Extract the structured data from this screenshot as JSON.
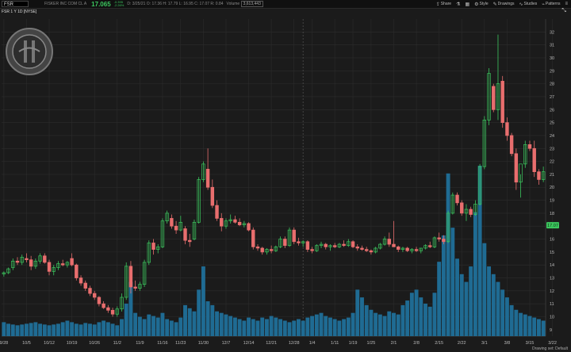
{
  "header": {
    "symbol": "FSR",
    "company": "FISKER INC COM CL A",
    "last": "17.065",
    "change": "-0.395",
    "change_pct": "-2.26%",
    "quote": "D: 3/25/21  O: 17.36  H: 17.79  L: 16.95  C: 17.07  R: 0.84",
    "volume_label": "Volume",
    "volume_value": "3,613,443",
    "period": "FSR 1 Y 1D [NYSE]"
  },
  "toolbar": {
    "share": "Share",
    "style": "Style",
    "drawings": "Drawings",
    "studies": "Studies",
    "patterns": "Patterns"
  },
  "logo_text": "FISKER",
  "status": "Drawing set: Default",
  "price_tag": "17.07",
  "colors": {
    "up": "#3cc65e",
    "down": "#e86e6e",
    "volume": "#1f6b93",
    "background": "#1b1b1b",
    "grid": "#2c2c2c"
  },
  "chart_data": {
    "type": "candlestick",
    "price_axis": {
      "ylim": [
        8.5,
        33
      ],
      "ticks": [
        9,
        10,
        11,
        12,
        13,
        14,
        15,
        16,
        17,
        18,
        19,
        20,
        21,
        22,
        23,
        24,
        25,
        26,
        27,
        28,
        29,
        30,
        31,
        32
      ],
      "tick_labels": [
        "9",
        "10",
        "11",
        "12",
        "13",
        "14",
        "15",
        "16",
        "17",
        "18",
        "19",
        "20",
        "21",
        "22",
        "23",
        "24",
        "25",
        "26",
        "27",
        "28",
        "29",
        "30",
        "31",
        "32"
      ]
    },
    "x_axis": {
      "labels": [
        "9/28",
        "10/5",
        "10/12",
        "10/19",
        "10/26",
        "11/2",
        "11/9",
        "11/16",
        "11/23",
        "11/30",
        "12/7",
        "12/14",
        "12/21",
        "12/28",
        "1/4",
        "1/11",
        "1/19",
        "1/25",
        "2/1",
        "2/8",
        "2/15",
        "2/22",
        "3/1",
        "3/8",
        "3/15",
        "3/22"
      ],
      "label_index": [
        0,
        5,
        10,
        15,
        20,
        25,
        30,
        35,
        39,
        44,
        49,
        54,
        59,
        64,
        68,
        73,
        77,
        81,
        86,
        91,
        96,
        101,
        106,
        111,
        116,
        121
      ]
    },
    "candles": [
      [
        13.3,
        13.5,
        13.1,
        13.4
      ],
      [
        13.4,
        13.8,
        13.3,
        13.7
      ],
      [
        13.8,
        14.5,
        13.6,
        14.3
      ],
      [
        14.3,
        14.6,
        14.0,
        14.2
      ],
      [
        14.2,
        14.8,
        14.0,
        14.6
      ],
      [
        14.5,
        14.9,
        14.2,
        14.4
      ],
      [
        14.4,
        14.7,
        13.6,
        13.9
      ],
      [
        13.9,
        14.5,
        13.7,
        14.3
      ],
      [
        14.3,
        14.9,
        14.1,
        14.7
      ],
      [
        14.7,
        14.9,
        14.1,
        14.2
      ],
      [
        14.2,
        14.4,
        13.2,
        13.5
      ],
      [
        13.5,
        14.0,
        13.2,
        13.8
      ],
      [
        13.8,
        14.3,
        13.6,
        14.1
      ],
      [
        14.1,
        14.4,
        13.9,
        14.0
      ],
      [
        14.0,
        14.3,
        13.8,
        14.2
      ],
      [
        14.5,
        14.9,
        13.9,
        14.0
      ],
      [
        14.0,
        14.1,
        12.8,
        13.0
      ],
      [
        13.0,
        13.2,
        12.4,
        12.6
      ],
      [
        12.6,
        12.8,
        12.0,
        12.2
      ],
      [
        12.2,
        12.4,
        11.6,
        11.8
      ],
      [
        11.8,
        12.0,
        11.3,
        11.5
      ],
      [
        11.5,
        11.6,
        10.8,
        11.0
      ],
      [
        11.0,
        11.2,
        10.6,
        10.7
      ],
      [
        10.7,
        10.9,
        10.3,
        10.5
      ],
      [
        10.5,
        10.7,
        10.0,
        10.2
      ],
      [
        10.2,
        10.8,
        10.0,
        10.6
      ],
      [
        10.6,
        11.8,
        10.4,
        11.5
      ],
      [
        11.5,
        14.2,
        11.3,
        13.9
      ],
      [
        13.9,
        14.3,
        11.8,
        12.3
      ],
      [
        12.3,
        12.8,
        12.0,
        12.2
      ],
      [
        12.2,
        12.7,
        12.0,
        12.5
      ],
      [
        12.5,
        14.4,
        12.3,
        14.2
      ],
      [
        14.2,
        15.9,
        14.0,
        15.7
      ],
      [
        15.7,
        16.0,
        14.8,
        15.2
      ],
      [
        15.2,
        15.6,
        14.9,
        15.4
      ],
      [
        15.4,
        17.6,
        15.3,
        17.4
      ],
      [
        17.4,
        18.2,
        17.2,
        18.0
      ],
      [
        17.6,
        17.9,
        16.8,
        17.0
      ],
      [
        17.0,
        17.4,
        16.4,
        16.7
      ],
      [
        16.7,
        17.8,
        16.6,
        17.3
      ],
      [
        16.8,
        17.0,
        15.6,
        15.9
      ],
      [
        15.9,
        16.4,
        15.4,
        15.8
      ],
      [
        16.0,
        17.5,
        15.9,
        17.3
      ],
      [
        17.3,
        20.8,
        17.2,
        20.6
      ],
      [
        20.6,
        22.0,
        20.4,
        21.8
      ],
      [
        21.4,
        23.0,
        19.8,
        20.0
      ],
      [
        20.0,
        20.6,
        18.4,
        18.6
      ],
      [
        18.6,
        19.0,
        17.4,
        17.6
      ],
      [
        17.6,
        18.0,
        16.6,
        17.0
      ],
      [
        17.0,
        17.6,
        16.8,
        17.4
      ],
      [
        17.4,
        17.9,
        17.2,
        17.5
      ],
      [
        17.5,
        17.8,
        17.2,
        17.3
      ],
      [
        17.3,
        17.6,
        17.0,
        17.1
      ],
      [
        17.1,
        17.4,
        16.9,
        17.2
      ],
      [
        17.2,
        17.3,
        16.6,
        16.7
      ],
      [
        16.7,
        16.9,
        15.2,
        15.4
      ],
      [
        15.4,
        15.6,
        15.1,
        15.3
      ],
      [
        15.3,
        15.4,
        14.8,
        15.0
      ],
      [
        15.0,
        15.3,
        14.8,
        15.2
      ],
      [
        15.2,
        15.5,
        14.9,
        15.1
      ],
      [
        15.1,
        15.5,
        15.0,
        15.4
      ],
      [
        15.4,
        16.2,
        15.3,
        16.0
      ],
      [
        16.0,
        16.2,
        15.3,
        15.5
      ],
      [
        15.5,
        16.9,
        15.4,
        16.7
      ],
      [
        16.7,
        16.9,
        15.6,
        15.8
      ],
      [
        15.8,
        16.1,
        15.5,
        15.7
      ],
      [
        15.7,
        15.9,
        15.4,
        15.8
      ],
      [
        15.8,
        15.9,
        15.0,
        15.2
      ],
      [
        15.2,
        15.4,
        14.9,
        15.1
      ],
      [
        15.1,
        15.6,
        15.0,
        15.5
      ],
      [
        15.5,
        15.8,
        15.3,
        15.6
      ],
      [
        15.6,
        15.7,
        15.2,
        15.4
      ],
      [
        15.4,
        15.6,
        15.1,
        15.5
      ],
      [
        15.5,
        15.7,
        15.3,
        15.4
      ],
      [
        15.4,
        15.7,
        15.3,
        15.6
      ],
      [
        15.6,
        15.9,
        15.4,
        15.5
      ],
      [
        15.5,
        16.0,
        15.4,
        15.8
      ],
      [
        15.8,
        15.9,
        15.3,
        15.4
      ],
      [
        15.4,
        15.6,
        15.1,
        15.3
      ],
      [
        15.3,
        15.5,
        15.1,
        15.2
      ],
      [
        15.2,
        15.4,
        15.0,
        15.1
      ],
      [
        15.1,
        15.2,
        14.8,
        15.0
      ],
      [
        15.0,
        15.4,
        14.9,
        15.3
      ],
      [
        15.3,
        15.7,
        15.2,
        15.6
      ],
      [
        15.6,
        16.2,
        15.5,
        16.0
      ],
      [
        16.0,
        16.5,
        15.4,
        15.6
      ],
      [
        15.6,
        17.4,
        15.5,
        15.4
      ],
      [
        15.4,
        15.5,
        15.0,
        15.2
      ],
      [
        15.2,
        15.4,
        15.0,
        15.3
      ],
      [
        15.3,
        15.4,
        15.0,
        15.1
      ],
      [
        15.1,
        15.3,
        14.9,
        15.2
      ],
      [
        15.2,
        15.4,
        15.0,
        15.1
      ],
      [
        15.1,
        15.3,
        14.9,
        15.3
      ],
      [
        15.3,
        15.6,
        15.2,
        15.5
      ],
      [
        15.5,
        15.8,
        15.3,
        15.4
      ],
      [
        15.4,
        16.2,
        15.3,
        16.1
      ],
      [
        16.1,
        16.5,
        15.8,
        16.0
      ],
      [
        16.0,
        16.3,
        15.6,
        15.8
      ],
      [
        15.8,
        18.2,
        15.7,
        18.0
      ],
      [
        18.0,
        19.6,
        17.9,
        19.4
      ],
      [
        19.4,
        19.6,
        18.6,
        18.8
      ],
      [
        18.8,
        19.0,
        17.8,
        18.0
      ],
      [
        18.0,
        18.7,
        17.4,
        18.3
      ],
      [
        18.3,
        18.5,
        17.7,
        17.9
      ],
      [
        17.9,
        19.0,
        17.8,
        18.7
      ],
      [
        18.7,
        21.8,
        18.6,
        21.6
      ],
      [
        21.6,
        25.5,
        21.4,
        25.2
      ],
      [
        25.2,
        29.2,
        24.8,
        28.8
      ],
      [
        27.8,
        28.0,
        25.8,
        26.0
      ],
      [
        26.0,
        31.8,
        25.2,
        28.0
      ],
      [
        28.2,
        28.6,
        24.6,
        25.0
      ],
      [
        25.0,
        25.4,
        23.6,
        24.0
      ],
      [
        24.0,
        24.2,
        22.4,
        22.6
      ],
      [
        22.6,
        23.0,
        19.8,
        20.4
      ],
      [
        20.4,
        21.0,
        19.2,
        21.8
      ],
      [
        21.8,
        23.6,
        21.5,
        23.3
      ],
      [
        23.3,
        23.6,
        22.8,
        23.0
      ],
      [
        23.0,
        23.6,
        20.8,
        21.2
      ],
      [
        21.2,
        21.4,
        20.2,
        20.6
      ],
      [
        20.6,
        21.6,
        20.4,
        21.2
      ]
    ],
    "volume": [
      18,
      16,
      15,
      14,
      15,
      16,
      17,
      18,
      16,
      15,
      14,
      15,
      16,
      18,
      20,
      18,
      16,
      15,
      17,
      16,
      15,
      18,
      20,
      18,
      16,
      14,
      22,
      42,
      70,
      30,
      25,
      22,
      28,
      26,
      24,
      30,
      22,
      20,
      18,
      24,
      40,
      36,
      32,
      60,
      90,
      45,
      40,
      32,
      30,
      28,
      26,
      24,
      22,
      20,
      24,
      22,
      20,
      24,
      22,
      26,
      24,
      22,
      20,
      18,
      20,
      22,
      20,
      24,
      26,
      28,
      30,
      26,
      24,
      22,
      20,
      22,
      24,
      30,
      60,
      50,
      40,
      34,
      30,
      28,
      26,
      32,
      30,
      28,
      40,
      46,
      56,
      60,
      50,
      42,
      38,
      56,
      96,
      130,
      210,
      140,
      100,
      80,
      70,
      90,
      160,
      220,
      120,
      90,
      80,
      70,
      60,
      50,
      40,
      34,
      30,
      28,
      26,
      24,
      22,
      20
    ],
    "price_tag": 17.07
  }
}
